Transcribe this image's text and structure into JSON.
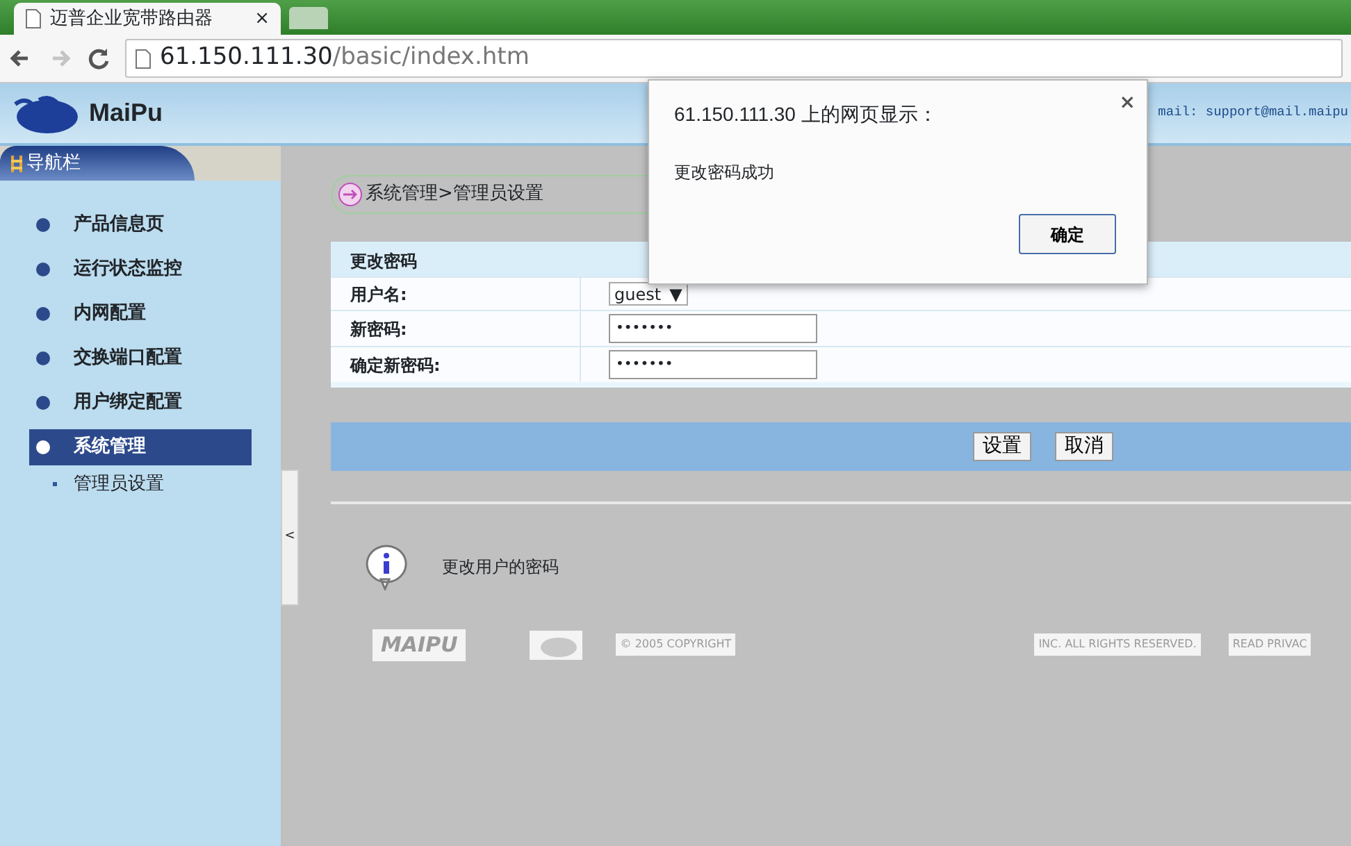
{
  "browser": {
    "tab": {
      "title": "迈普企业宽带路由器",
      "close": "×"
    },
    "nav_buttons": [
      {
        "kind": "back",
        "disabled": false
      },
      {
        "kind": "forward",
        "disabled": true
      },
      {
        "kind": "reload",
        "disabled": false
      }
    ],
    "address": {
      "host": "61.150.111.30",
      "path": "/basic/index.htm"
    }
  },
  "header": {
    "brand": "MaiPu",
    "contact": "mail: support@mail.maipu"
  },
  "sidebar": {
    "title": "导航栏",
    "collapse_handle": "<",
    "items": [
      {
        "label": "产品信息页",
        "selected": false
      },
      {
        "label": "运行状态监控",
        "selected": false
      },
      {
        "label": "内网配置",
        "selected": false
      },
      {
        "label": "交换端口配置",
        "selected": false
      },
      {
        "label": "用户绑定配置",
        "selected": false
      },
      {
        "label": "系统管理",
        "selected": true,
        "children": [
          {
            "label": "管理员设置"
          }
        ]
      }
    ]
  },
  "breadcrumb": "系统管理>管理员设置",
  "form": {
    "title": "更改密码",
    "rows": [
      {
        "label": "用户名:",
        "kind": "select",
        "value": "guest",
        "caret": "▼"
      },
      {
        "label": "新密码:",
        "kind": "password",
        "value": "•••••••"
      },
      {
        "label": "确定新密码:",
        "kind": "password",
        "value": "•••••••"
      }
    ],
    "buttons": [
      "设置",
      "取消"
    ]
  },
  "help_text": "更改用户的密码",
  "footer": [
    "MAIPU",
    "© 2005 COPYRIGHT",
    "INC. ALL RIGHTS RESERVED.",
    "READ PRIVAC"
  ],
  "dialog": {
    "title": "61.150.111.30 上的网页显示：",
    "close": "×",
    "message": "更改密码成功",
    "button": "确定"
  }
}
